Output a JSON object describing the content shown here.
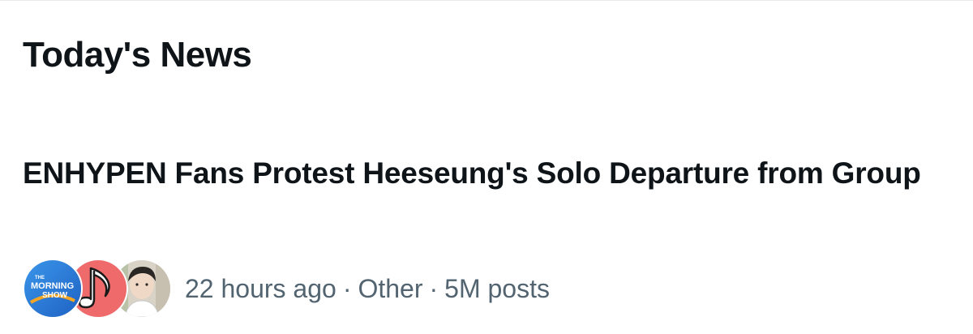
{
  "section": {
    "title": "Today's News"
  },
  "news_item": {
    "headline": "ENHYPEN Fans Protest Heeseung's Solo Departure from Group",
    "avatars": [
      {
        "icon": "morning-show-logo",
        "text_lines": [
          "THE",
          "MORNING",
          "SHOW"
        ],
        "color": "#2f7fd8"
      },
      {
        "icon": "music-note-logo",
        "color": "#ef6b6b"
      },
      {
        "icon": "person-photo",
        "color": "#d9d2c6"
      }
    ],
    "time": "22 hours ago",
    "category": "Other",
    "posts": "5M posts",
    "separator": "·"
  }
}
